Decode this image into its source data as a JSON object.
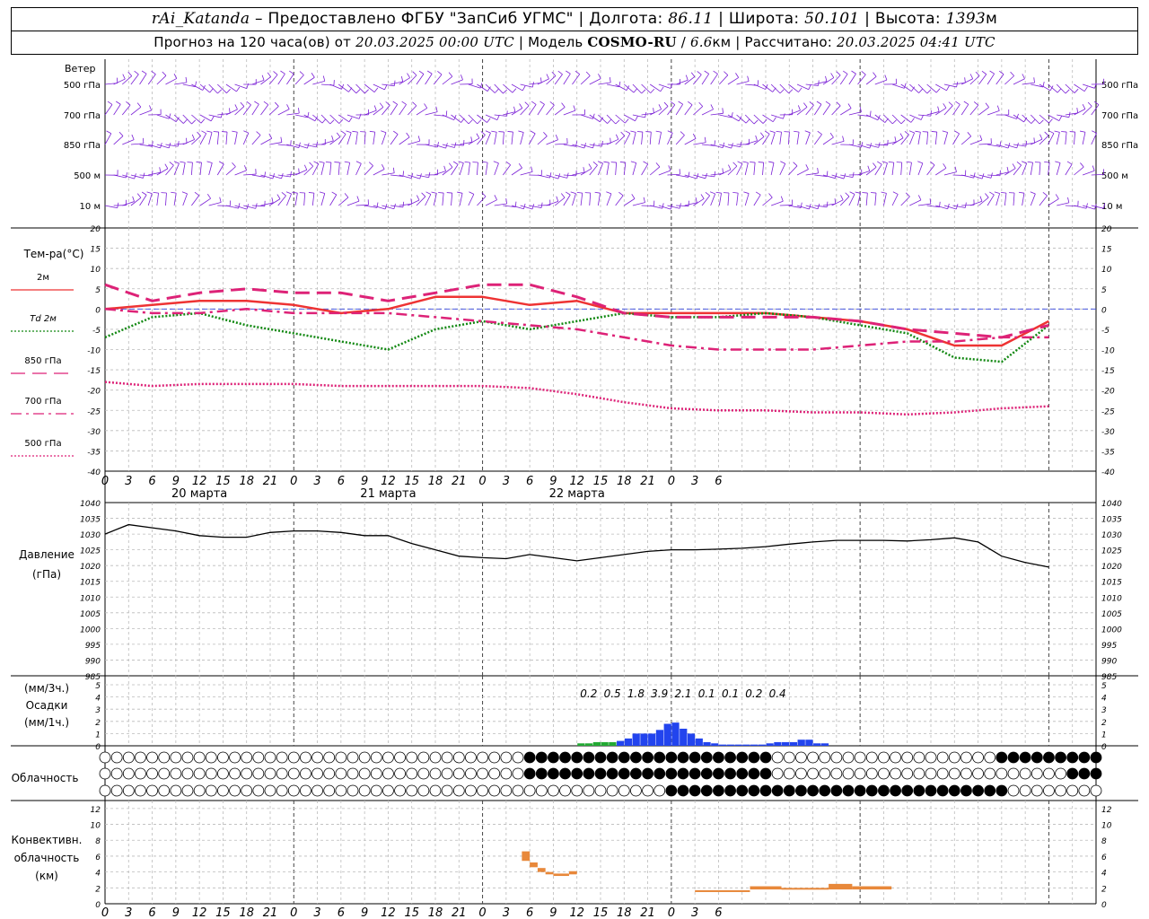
{
  "header": {
    "line1": {
      "station": "rAi_Katanda",
      "provider": "– Предоставлено ФГБУ \"ЗапСиб УГМС\" | Долгота: ",
      "lon": "86.11",
      "lat_label": " | Широта: ",
      "lat": "50.101",
      "alt_label": " | Высота: ",
      "alt": "1393",
      "alt_unit": "м"
    },
    "line2": {
      "forecast_label": "Прогноз на 120 часа(ов) от ",
      "forecast_start": "20.03.2025 00:00 UTC",
      "model_label": " | Модель ",
      "model": "COSMO-RU",
      "sep": " / ",
      "res": "6.6",
      "res_unit": "км",
      "calc_label": " | Рассчитано: ",
      "calc_time": "20.03.2025 04:41 UTC"
    }
  },
  "chart_data": [
    {
      "type": "wind-barbs",
      "title": "Ветер",
      "levels": [
        "500 гПа",
        "700 гПа",
        "850 гПа",
        "500 м",
        "10 м"
      ]
    },
    {
      "type": "line",
      "ylabel": "Тем-ра(°C)",
      "ylim": [
        -40,
        20
      ],
      "yticks": [
        20,
        15,
        10,
        5,
        0,
        -5,
        -10,
        -15,
        -20,
        -25,
        -30,
        -35,
        -40
      ],
      "x_hours": [
        0,
        6,
        12,
        18,
        24,
        30,
        36,
        42,
        48,
        54,
        60,
        66,
        72,
        78,
        84,
        90,
        96,
        102,
        108,
        114,
        120
      ],
      "series": [
        {
          "name": "2м",
          "color": "#ee3333",
          "style": "solid",
          "values": [
            0,
            1,
            2,
            2,
            1,
            -1,
            0,
            3,
            3,
            1,
            2,
            -1,
            -1,
            -1,
            -1,
            -2,
            -3,
            -5,
            -9,
            -9,
            -3
          ]
        },
        {
          "name": "Td 2м",
          "color": "#118811",
          "style": "dotted",
          "values": [
            -7,
            -2,
            -1,
            -4,
            -6,
            -8,
            -10,
            -5,
            -3,
            -5,
            -3,
            -1,
            -2,
            -2,
            -1,
            -2,
            -4,
            -6,
            -12,
            -13,
            -4
          ]
        },
        {
          "name": "850 гПа",
          "color": "#dd2277",
          "style": "dash",
          "values": [
            6,
            2,
            4,
            5,
            4,
            4,
            2,
            4,
            6,
            6,
            3,
            -1,
            -2,
            -2,
            -2,
            -2,
            -3,
            -5,
            -6,
            -7,
            -4
          ]
        },
        {
          "name": "700 гПа",
          "color": "#dd2277",
          "style": "dashdot",
          "values": [
            0,
            -1,
            -1,
            0,
            -1,
            -1,
            -1,
            -2,
            -3,
            -4,
            -5,
            -7,
            -9,
            -10,
            -10,
            -10,
            -9,
            -8,
            -8,
            -7,
            -7
          ]
        },
        {
          "name": "500 гПа",
          "color": "#dd2277",
          "style": "dotted",
          "values": [
            -18,
            -19,
            -18.5,
            -18.5,
            -18.5,
            -19,
            -19,
            -19,
            -19,
            -19.5,
            -21,
            -23,
            -24.5,
            -25,
            -25,
            -25.5,
            -25.5,
            -26,
            -25.5,
            -24.5,
            -24
          ]
        }
      ],
      "x_tick_labels": [
        "0",
        "3",
        "6",
        "9",
        "12",
        "15",
        "18",
        "21",
        "0",
        "3",
        "6",
        "9",
        "12",
        "15",
        "18",
        "21",
        "0",
        "3",
        "6",
        "9",
        "12",
        "15",
        "18",
        "21",
        "0",
        "3",
        "6"
      ],
      "day_labels": [
        "20 марта",
        "21 марта",
        "22 марта"
      ]
    },
    {
      "type": "line",
      "ylabel": "Давление",
      "ylabel2": "(гПа)",
      "ylim": [
        985,
        1040
      ],
      "yticks": [
        1040,
        1035,
        1030,
        1025,
        1020,
        1015,
        1010,
        1005,
        1000,
        995,
        990,
        985
      ],
      "x_hours": [
        0,
        3,
        6,
        9,
        12,
        15,
        18,
        21,
        24,
        27,
        30,
        33,
        36,
        39,
        42,
        45,
        48,
        51,
        54,
        57,
        60,
        63,
        66,
        69,
        72,
        75,
        78,
        81,
        84,
        87,
        90,
        93,
        96,
        99,
        102,
        105,
        108,
        111,
        114,
        117,
        120
      ],
      "series": [
        {
          "name": "Давление",
          "color": "#000000",
          "values": [
            1030,
            1033,
            1032,
            1031,
            1029.5,
            1029,
            1029,
            1030.5,
            1031,
            1031,
            1030.5,
            1029.5,
            1029.5,
            1027,
            1025,
            1023,
            1022.5,
            1022.2,
            1023.5,
            1022.5,
            1021.5,
            1022.5,
            1023.5,
            1024.5,
            1025,
            1025,
            1025.2,
            1025.5,
            1026,
            1026.8,
            1027.5,
            1028,
            1028,
            1028,
            1027.8,
            1028.2,
            1028.8,
            1027.5,
            1023,
            1021,
            1019.5
          ]
        }
      ]
    },
    {
      "type": "bar",
      "ylabel_top": "(мм/3ч.)",
      "ylabel": "Осадки",
      "ylabel_bottom": "(мм/1ч.)",
      "ylim": [
        0,
        5
      ],
      "yticks": [
        5,
        4,
        3,
        2,
        1,
        0
      ],
      "totals": [
        "0.2",
        "0.5",
        "1.8",
        "3.9",
        "2.1",
        "0.1",
        "0.1",
        "0.2",
        "0.4"
      ],
      "hours": [
        61,
        62,
        63,
        64,
        65,
        66,
        67,
        68,
        69,
        70,
        71,
        72,
        73,
        74,
        75,
        76,
        77,
        78,
        79,
        80,
        81,
        82,
        83,
        84,
        85,
        86,
        87,
        88,
        89,
        90,
        91,
        92,
        93,
        94,
        95,
        96
      ],
      "values": [
        0.2,
        0.2,
        0.3,
        0.3,
        0.3,
        0.4,
        0.6,
        1.0,
        1.0,
        1.0,
        1.3,
        1.8,
        1.9,
        1.4,
        1.0,
        0.6,
        0.3,
        0.2,
        0.1,
        0.1,
        0.1,
        0.1,
        0.1,
        0.1,
        0.2,
        0.3,
        0.3,
        0.3,
        0.5,
        0.5,
        0.2,
        0.2,
        0,
        0,
        0,
        0
      ],
      "colors_note": [
        "green",
        "blue"
      ]
    },
    {
      "type": "cloud-circles",
      "ylabel": "Облачность",
      "rows": 3,
      "legend": "filled=overcast, empty=clear"
    },
    {
      "type": "bar",
      "ylabel": "Конвективн.",
      "ylabel2": "облачность",
      "ylabel3": "(км)",
      "ylim": [
        0,
        13
      ],
      "yticks": [
        12,
        10,
        8,
        6,
        4,
        2,
        0
      ],
      "segments": [
        {
          "x0": 53,
          "x1": 54,
          "top": 6.6,
          "bottom": 5.4
        },
        {
          "x0": 54,
          "x1": 55,
          "top": 5.2,
          "bottom": 4.6
        },
        {
          "x0": 55,
          "x1": 56,
          "top": 4.5,
          "bottom": 4.0
        },
        {
          "x0": 56,
          "x1": 57,
          "top": 4.0,
          "bottom": 3.7
        },
        {
          "x0": 57,
          "x1": 59,
          "top": 3.8,
          "bottom": 3.5
        },
        {
          "x0": 59,
          "x1": 60,
          "top": 4.1,
          "bottom": 3.7
        },
        {
          "x0": 75,
          "x1": 82,
          "top": 1.7,
          "bottom": 1.5
        },
        {
          "x0": 82,
          "x1": 86,
          "top": 2.2,
          "bottom": 1.8
        },
        {
          "x0": 86,
          "x1": 92,
          "top": 2.0,
          "bottom": 1.8
        },
        {
          "x0": 92,
          "x1": 95,
          "top": 2.5,
          "bottom": 1.8
        },
        {
          "x0": 95,
          "x1": 100,
          "top": 2.2,
          "bottom": 1.8
        }
      ]
    }
  ]
}
